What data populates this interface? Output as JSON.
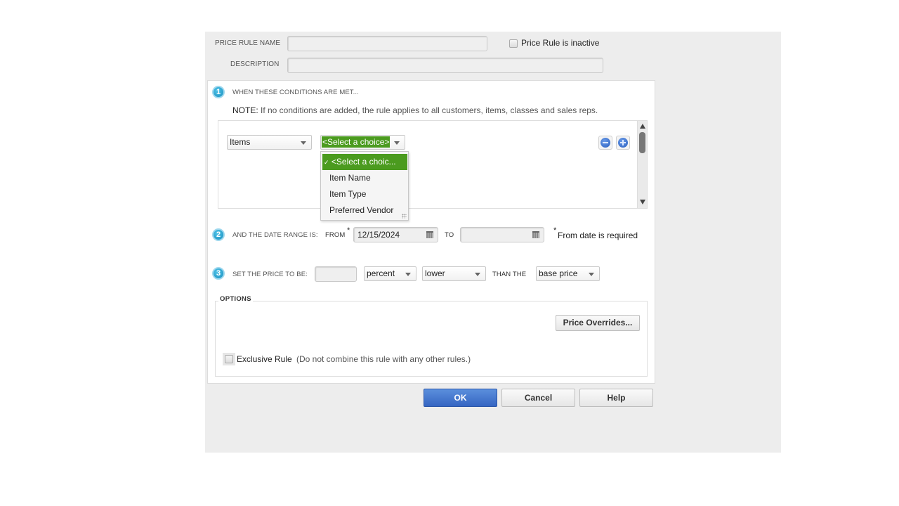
{
  "header": {
    "price_rule_name_label": "PRICE RULE NAME",
    "price_rule_name_value": "",
    "inactive_label": "Price Rule is inactive",
    "inactive_checked": false,
    "description_label": "DESCRIPTION",
    "description_value": ""
  },
  "section1": {
    "number": "1",
    "title": "WHEN THESE CONDITIONS ARE MET...",
    "note_label": "NOTE:",
    "note_text": "If no conditions are added, the rule applies to all customers, items, classes and sales reps.",
    "condition": {
      "type_value": "Items",
      "choice_value": "<Select a choice>"
    },
    "dropdown": {
      "check_mark": "✓",
      "options": [
        {
          "label": "<Select a choic...",
          "selected": true
        },
        {
          "label": "Item Name",
          "selected": false
        },
        {
          "label": "Item Type",
          "selected": false
        },
        {
          "label": "Preferred Vendor",
          "selected": false
        }
      ]
    },
    "remove_icon": "minus-circle-icon",
    "add_icon": "plus-circle-icon"
  },
  "section2": {
    "number": "2",
    "title": "AND THE DATE RANGE IS:",
    "from_label": "FROM",
    "required_mark": "*",
    "from_value": "12/15/2024",
    "to_label": "TO",
    "to_value": "",
    "required_note": "From date is required",
    "calendar_icon": "calendar-icon"
  },
  "section3": {
    "number": "3",
    "title": "SET THE PRICE TO BE:",
    "amount_value": "",
    "unit_value": "percent",
    "direction_value": "lower",
    "than_label": "THAN THE",
    "base_value": "base price"
  },
  "options": {
    "title": "OPTIONS",
    "price_overrides_label": "Price Overrides...",
    "exclusive_label": "Exclusive Rule",
    "exclusive_checked": false,
    "exclusive_hint": "(Do not combine this rule with any other rules.)"
  },
  "footer": {
    "ok_label": "OK",
    "cancel_label": "Cancel",
    "help_label": "Help"
  },
  "colors": {
    "accent_green": "#4b9b1f",
    "primary_blue": "#3a6cc8",
    "badge_cyan": "#1a8fbf"
  }
}
